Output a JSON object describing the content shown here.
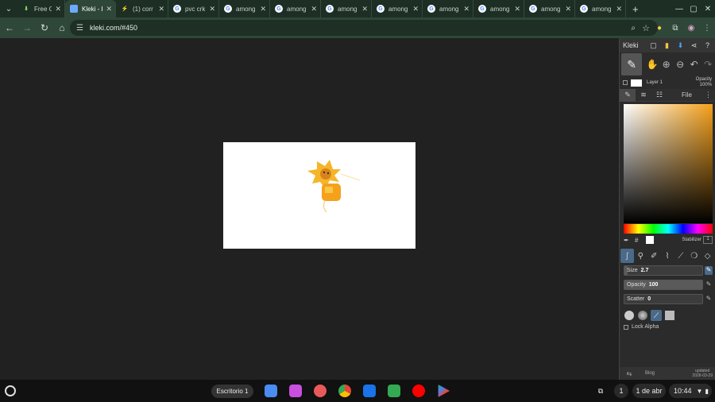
{
  "browser": {
    "tabs": [
      {
        "title": "Free On",
        "icon": "download-icon",
        "active": false
      },
      {
        "title": "Kleki - F",
        "icon": "kleki-icon",
        "active": true
      },
      {
        "title": "(1) corr",
        "icon": "bolt-icon",
        "active": false
      },
      {
        "title": "pvc crk",
        "icon": "google-icon",
        "active": false
      },
      {
        "title": "among",
        "icon": "google-icon",
        "active": false
      },
      {
        "title": "among",
        "icon": "google-icon",
        "active": false
      },
      {
        "title": "among",
        "icon": "google-icon",
        "active": false
      },
      {
        "title": "among",
        "icon": "google-icon",
        "active": false
      },
      {
        "title": "among",
        "icon": "google-icon",
        "active": false
      },
      {
        "title": "among",
        "icon": "google-icon",
        "active": false
      },
      {
        "title": "among",
        "icon": "google-icon",
        "active": false
      },
      {
        "title": "among",
        "icon": "google-icon",
        "active": false
      }
    ],
    "url": "kleki.com/#450"
  },
  "kleki": {
    "logo": "Kleki",
    "layer": {
      "name": "Layer 1",
      "opacity_label": "Opacity",
      "opacity_value": "100%"
    },
    "file_tab": "File",
    "stabilizer_label": "Stabilizer",
    "stabilizer_value": "1",
    "sliders": {
      "size": {
        "label": "Size",
        "value": "2.7",
        "fraction": 0.04
      },
      "opacity": {
        "label": "Opacity",
        "value": "100",
        "fraction": 1.0
      },
      "scatter": {
        "label": "Scatter",
        "value": "0",
        "fraction": 0.0
      }
    },
    "lock_alpha": "Lock Alpha",
    "footer": {
      "blog": "Blog",
      "updated_label": "updated",
      "updated_date": "2026-03-29"
    },
    "accent_color": "#f5a11a"
  },
  "shelf": {
    "desk_label": "Escritorio 1",
    "notification_count": "1",
    "date": "1 de abr",
    "time": "10:44"
  }
}
